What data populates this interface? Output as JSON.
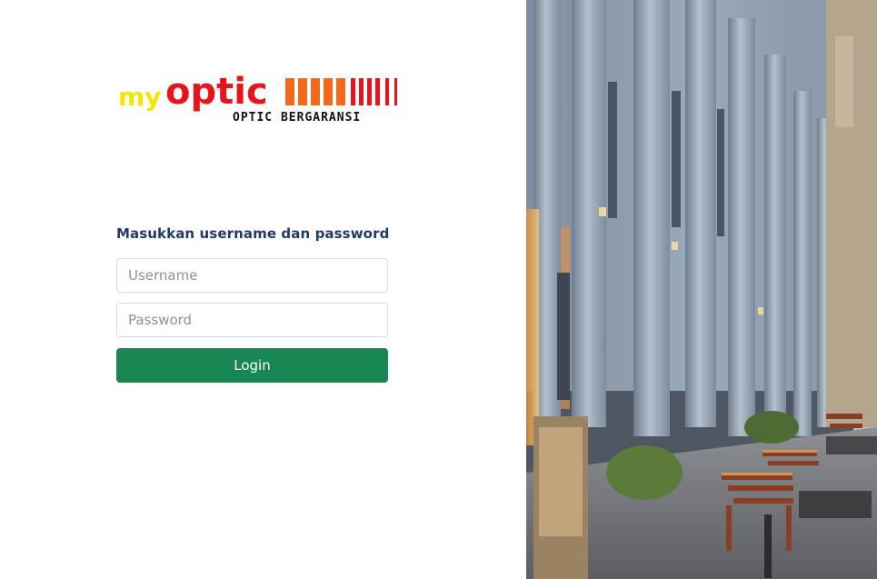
{
  "brand": {
    "logo_my": "my",
    "logo_optic": "optic",
    "logo_tagline": "OPTIC BERGARANSI",
    "colors": {
      "my": "#f2e600",
      "optic": "#e8141c",
      "bars_orange": "#f26a1b",
      "bars_red": "#e8141c",
      "tagline": "#111111"
    }
  },
  "login": {
    "prompt": "Masukkan username dan password",
    "username_placeholder": "Username",
    "password_placeholder": "Password",
    "submit_label": "Login",
    "accent": "#198754"
  },
  "background_photo": {
    "icon": "building-colonnade-photo"
  }
}
